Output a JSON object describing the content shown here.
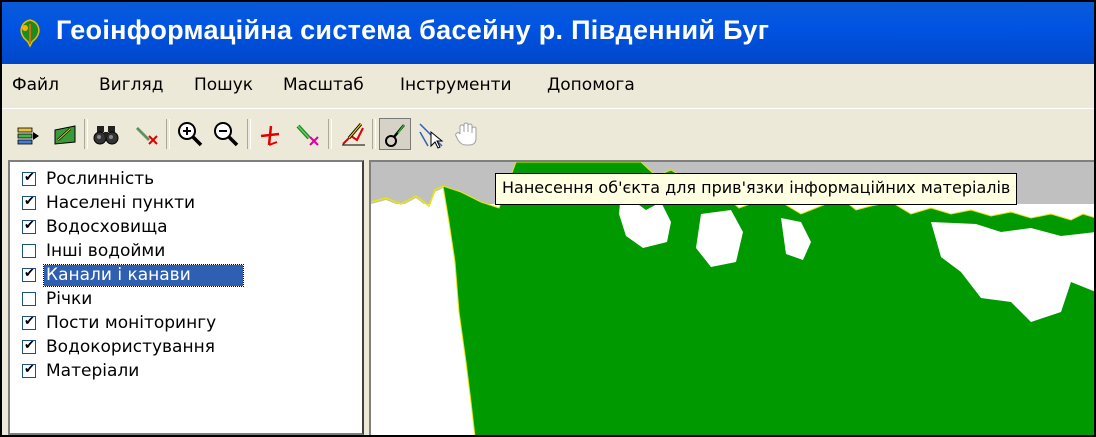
{
  "window": {
    "title": "Геоінформаційна система басейну р. Південний Буг",
    "icon": "leaf-app-icon",
    "titlebar_color": "#0054e3"
  },
  "menu": {
    "items": [
      {
        "label": "Файл"
      },
      {
        "label": "Вигляд"
      },
      {
        "label": "Пошук"
      },
      {
        "label": "Масштаб"
      },
      {
        "label": "Інструменти"
      },
      {
        "label": "Допомога"
      }
    ]
  },
  "toolbar": {
    "buttons": [
      {
        "icon": "layers-add-icon"
      },
      {
        "icon": "layers-edit-icon"
      },
      {
        "icon": "binoculars-icon"
      },
      {
        "icon": "clear-search-icon"
      },
      {
        "icon": "zoom-in-icon"
      },
      {
        "icon": "zoom-out-icon"
      },
      {
        "icon": "measure-icon"
      },
      {
        "icon": "remove-object-icon"
      },
      {
        "icon": "draw-object-icon"
      },
      {
        "icon": "link-object-icon",
        "pressed": true
      },
      {
        "icon": "select-tool-icon"
      },
      {
        "icon": "pan-hand-icon"
      }
    ]
  },
  "layers": {
    "items": [
      {
        "label": "Рослинність",
        "checked": true
      },
      {
        "label": "Населені пункти",
        "checked": true
      },
      {
        "label": "Водосховища",
        "checked": true
      },
      {
        "label": "Інші водойми",
        "checked": false
      },
      {
        "label": "Канали і канави",
        "checked": true,
        "selected": true
      },
      {
        "label": "Річки",
        "checked": false
      },
      {
        "label": "Пости моніторингу",
        "checked": true
      },
      {
        "label": "Водокористування",
        "checked": true
      },
      {
        "label": "Матеріали",
        "checked": true
      }
    ]
  },
  "map": {
    "vegetation_color": "#009900",
    "background_color": "#c0c0c0",
    "edge_color": "#e8e800"
  },
  "tooltip": {
    "text": "Нанесення об'єкта для прив'язки інформаційних матеріалів"
  }
}
